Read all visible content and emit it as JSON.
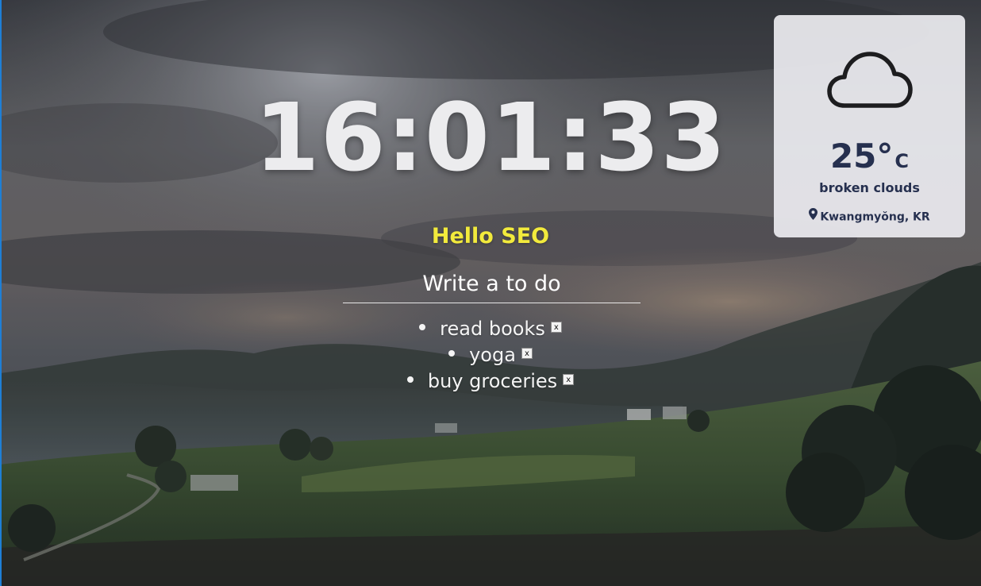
{
  "clock": {
    "time": "16:01:33"
  },
  "greeting": {
    "text": "Hello SEO"
  },
  "todo": {
    "input_value": "Write a to do",
    "items": [
      {
        "text": "read books",
        "delete_label": "x"
      },
      {
        "text": "yoga",
        "delete_label": "x"
      },
      {
        "text": "buy groceries",
        "delete_label": "x"
      }
    ]
  },
  "weather": {
    "icon": "cloud-icon",
    "temp_value": "25°",
    "temp_unit": "C",
    "description": "broken clouds",
    "location_icon": "location-pin-icon",
    "location": "Kwangmyŏng, KR"
  },
  "colors": {
    "greeting": "#f2ea3c",
    "clock": "#ececee",
    "weather_text": "#26304f",
    "weather_card": "#e9e9ed"
  },
  "background": {
    "description_icon": "landscape-wallpaper"
  }
}
